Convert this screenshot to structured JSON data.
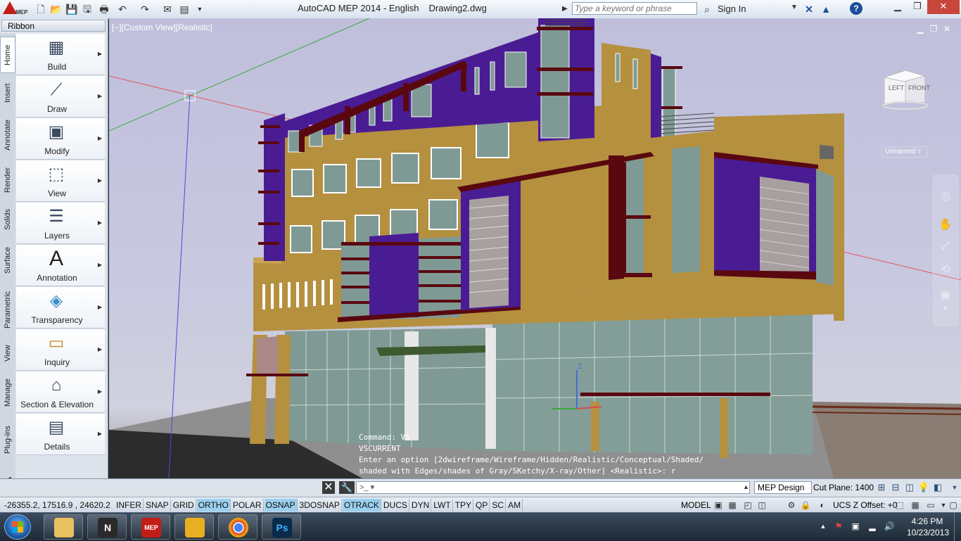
{
  "title_bar": {
    "app_name": "AutoCAD MEP 2014 - English",
    "document": "Drawing2.dwg",
    "app_logo_text": "MEP",
    "search_placeholder": "Type a keyword or phrase",
    "sign_in": "Sign In",
    "qat_icons": [
      "new-icon",
      "open-icon",
      "save-icon",
      "save-as-icon",
      "print-icon",
      "undo-icon",
      "redo-icon",
      "share-icon",
      "properties-icon",
      "dropdown-icon"
    ]
  },
  "ribbon": {
    "title": "Ribbon",
    "tabs": [
      "Home",
      "Insert",
      "Annotate",
      "Render",
      "Solids",
      "Surface",
      "Parametric",
      "View",
      "Manage",
      "Plug-ins"
    ],
    "active_tab": "Home",
    "panels": [
      {
        "label": "Build",
        "icon": "building-icon"
      },
      {
        "label": "Draw",
        "icon": "line-icon"
      },
      {
        "label": "Modify",
        "icon": "modify-icon"
      },
      {
        "label": "View",
        "icon": "cube-icon"
      },
      {
        "label": "Layers",
        "icon": "layers-icon"
      },
      {
        "label": "Annotation",
        "icon": "text-a-icon"
      },
      {
        "label": "Transparency",
        "icon": "transparency-icon"
      },
      {
        "label": "Inquiry",
        "icon": "ruler-icon"
      },
      {
        "label": "Section & Elevation",
        "icon": "section-icon"
      },
      {
        "label": "Details",
        "icon": "details-icon"
      }
    ]
  },
  "viewport": {
    "label": "[−][Custom View][Realistic]",
    "viewcube": {
      "left": "LEFT",
      "front": "FRONT"
    },
    "wcs_menu": "Unnamed"
  },
  "command": {
    "history": [
      "Command: VS",
      "VSCURRENT",
      "Enter an option [2dwireframe/Wireframe/Hidden/Realistic/Conceptual/Shaded/",
      "shaded with Edges/shades of Gray/SKetchy/X-ray/Other] <Realistic>: r"
    ],
    "prompt_symbol": ">_"
  },
  "command_row": {
    "workspace": "MEP Design",
    "cut_plane": "Cut Plane:  1400"
  },
  "status_bar": {
    "coords": "-26355.2, 17516.9 , 24620.2",
    "toggles": [
      {
        "label": "INFER",
        "on": false
      },
      {
        "label": "SNAP",
        "on": false
      },
      {
        "label": "GRID",
        "on": false
      },
      {
        "label": "ORTHO",
        "on": true
      },
      {
        "label": "POLAR",
        "on": false
      },
      {
        "label": "OSNAP",
        "on": true
      },
      {
        "label": "3DOSNAP",
        "on": false
      },
      {
        "label": "OTRACK",
        "on": true
      },
      {
        "label": "DUCS",
        "on": false
      },
      {
        "label": "DYN",
        "on": false
      },
      {
        "label": "LWT",
        "on": false
      },
      {
        "label": "TPY",
        "on": false
      },
      {
        "label": "QP",
        "on": false
      },
      {
        "label": "SC",
        "on": false
      },
      {
        "label": "AM",
        "on": false
      }
    ],
    "model": "MODEL",
    "ucs_offset": "UCS Z Offset:  +0"
  },
  "taskbar": {
    "apps": [
      {
        "name": "explorer",
        "label": ""
      },
      {
        "name": "navisworks",
        "label": "N"
      },
      {
        "name": "autocad-mep",
        "label": "MEP"
      },
      {
        "name": "winamp",
        "label": ""
      },
      {
        "name": "chrome",
        "label": ""
      },
      {
        "name": "photoshop",
        "label": "Ps"
      }
    ],
    "time": "4:26 PM",
    "date": "10/23/2013"
  },
  "colors": {
    "facade": "#b5903f",
    "purple": "#4a1c93",
    "maroon": "#5a0810",
    "glass": "#7f9a94",
    "sky": "#c4c4de",
    "ortho_on": "#9bd0ee"
  }
}
